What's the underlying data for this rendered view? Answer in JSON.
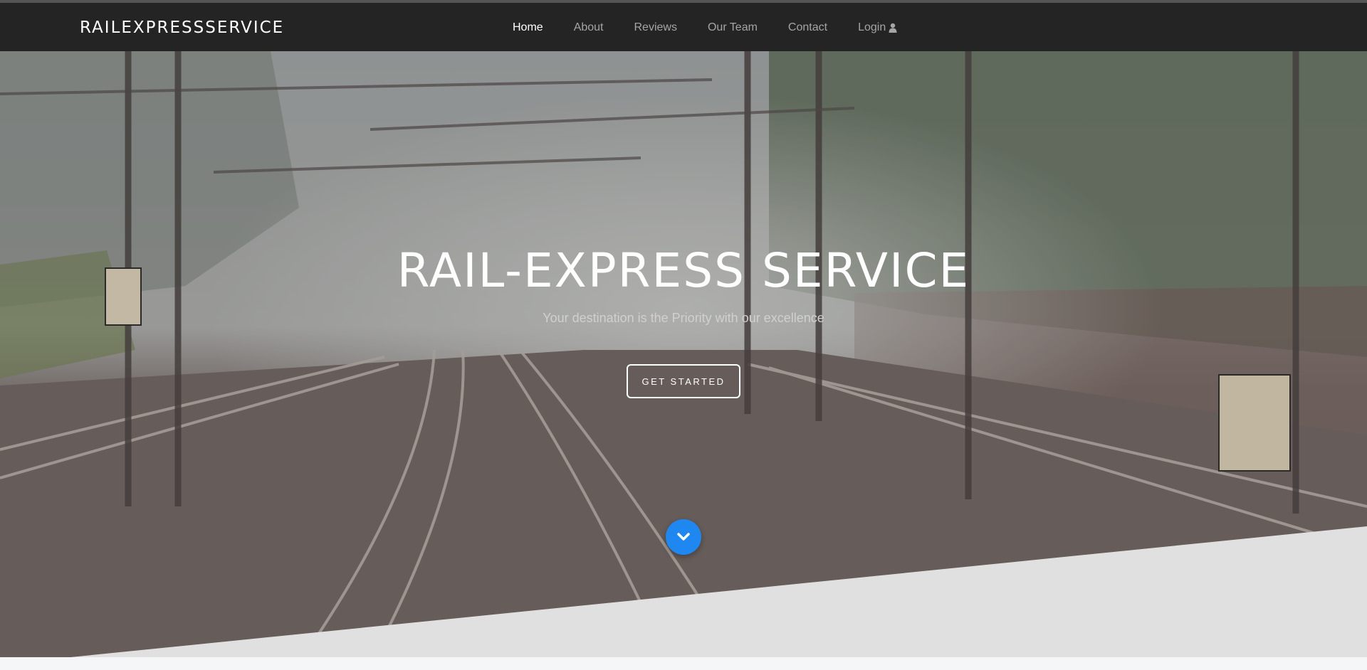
{
  "brand": "RAILEXPRESSSERVICE",
  "nav": {
    "items": [
      {
        "label": "Home",
        "active": true
      },
      {
        "label": "About",
        "active": false
      },
      {
        "label": "Reviews",
        "active": false
      },
      {
        "label": "Our Team",
        "active": false
      },
      {
        "label": "Contact",
        "active": false
      },
      {
        "label": "Login",
        "active": false,
        "icon": "user-icon"
      }
    ]
  },
  "hero": {
    "title": "RAIL-EXPRESS SERVICE",
    "subtitle": "Your destination is the Priority with our excellence",
    "cta_label": "GET STARTED",
    "scroll_icon": "chevron-down-icon"
  },
  "colors": {
    "navbar": "#242424",
    "nav_text": "#a5a5a5",
    "nav_active": "#ffffff",
    "scroll_button": "#1e88f0",
    "page_bg": "#f4f6f8"
  }
}
